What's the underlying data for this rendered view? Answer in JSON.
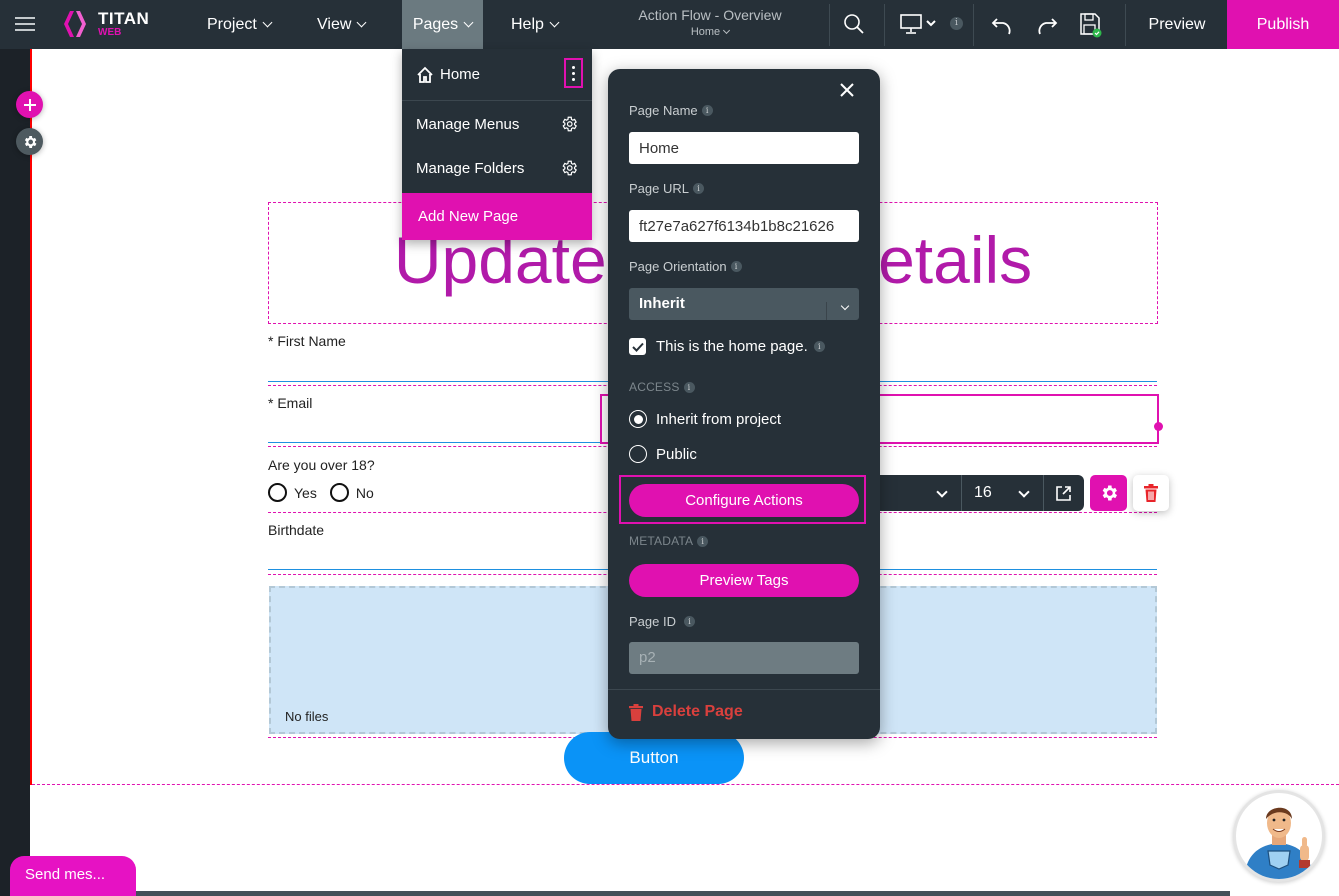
{
  "topbar": {
    "logo": {
      "name": "TITAN",
      "sub": "WEB"
    },
    "menus": [
      {
        "label": "Project"
      },
      {
        "label": "View"
      },
      {
        "label": "Pages",
        "active": true
      },
      {
        "label": "Help"
      }
    ],
    "doc_title": "Action Flow - Overview",
    "current_page": "Home",
    "device_info": "i",
    "preview_label": "Preview",
    "publish_label": "Publish"
  },
  "colors": {
    "brand": "#e011b0",
    "topbar": "#263038",
    "heading": "#b11aa9",
    "primary_button": "#0a93f7",
    "danger": "#d9403d"
  },
  "pages_menu": {
    "items": [
      {
        "label": "Home",
        "icon": "home-icon",
        "action_icon": "kebab-icon"
      },
      {
        "label": "Manage Menus",
        "icon": "gear-icon"
      },
      {
        "label": "Manage Folders",
        "icon": "gear-icon"
      }
    ],
    "add_label": "Add New Page"
  },
  "panel": {
    "page_name_label": "Page Name",
    "page_name_value": "Home",
    "page_url_label": "Page URL",
    "page_url_value": "ft27e7a627f6134b1b8c21626",
    "orientation_label": "Page Orientation",
    "orientation_value": "Inherit",
    "home_checkbox_label": "This is the home page.",
    "home_checked": true,
    "access_label": "ACCESS",
    "access_options": [
      {
        "label": "Inherit from project",
        "selected": true
      },
      {
        "label": "Public",
        "selected": false
      }
    ],
    "configure_actions_label": "Configure Actions",
    "metadata_label": "METADATA",
    "preview_tags_label": "Preview Tags",
    "page_id_label": "Page ID",
    "page_id_value": "p2",
    "delete_label": "Delete Page",
    "info_glyph": "i"
  },
  "canvas": {
    "heading": "Update Profile Details",
    "fields": [
      {
        "label": "* First Name"
      },
      {
        "label": "* Email"
      },
      {
        "label": "Are you over 18?",
        "options": [
          "Yes",
          "No"
        ]
      },
      {
        "label": "Birthdate"
      }
    ],
    "dropzone_text": "No files",
    "button_label": "Button"
  },
  "element_toolbar": {
    "font_size": "16"
  },
  "chat": {
    "send_label": "Send mes..."
  }
}
